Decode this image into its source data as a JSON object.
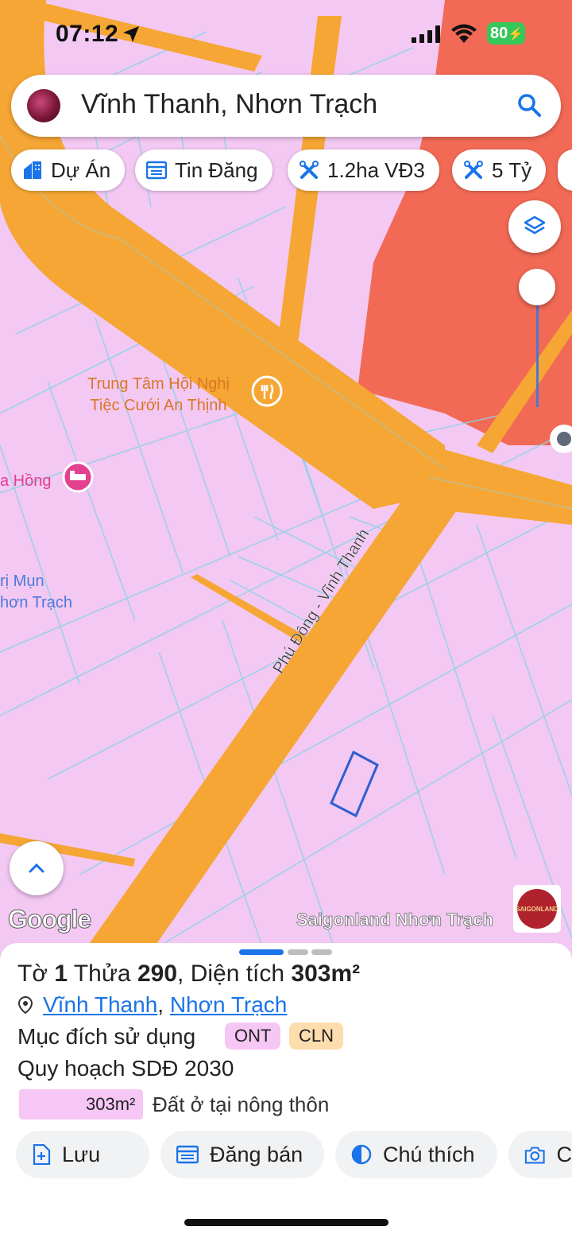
{
  "status": {
    "time": "07:12",
    "battery": "80"
  },
  "search": {
    "query": "Vĩnh Thanh, Nhơn Trạch"
  },
  "chips": [
    {
      "label": "Dự Án",
      "icon": "building-icon"
    },
    {
      "label": "Tin Đăng",
      "icon": "calendar-list-icon"
    },
    {
      "label": "1.2ha VĐ3",
      "icon": "tools-icon"
    },
    {
      "label": "5 Tỷ",
      "icon": "tools-icon"
    }
  ],
  "map": {
    "poi_event_line1": "Trung Tâm Hội Nghị",
    "poi_event_line2": "Tiệc Cưới An Thịnh",
    "poi_hotel": "a Hồng",
    "poi_clinic_line1": "rị Mụn",
    "poi_clinic_line2": "hơn Trạch",
    "road_name": "Phú Đông - Vĩnh Thanh",
    "google_label": "Google",
    "watermark": "Saigonland Nhơn Trạch",
    "logo_text": "SAIGONLAND",
    "colors": {
      "residential": "#f3c8f3",
      "road": "#f5a634",
      "commercial": "#f26a55",
      "parcel_lines": "#8fd3e8",
      "selected": "#2f5fd0"
    }
  },
  "sheet": {
    "title_prefix": "Tờ",
    "sheet_no": "1",
    "parcel_word": "Thửa",
    "parcel_no": "290",
    "area_label": "Diện tích",
    "area_value": "303m²",
    "address_part1": "Vĩnh Thanh",
    "address_sep": ",",
    "address_part2": "Nhơn Trạch",
    "usage_label": "Mục đích sử dụng",
    "usage_tags": [
      "ONT",
      "CLN"
    ],
    "plan_label": "Quy hoạch SDĐ 2030",
    "legend_area": "303m²",
    "legend_desc": "Đất ở tại nông thôn"
  },
  "actions": [
    {
      "label": "Lưu",
      "icon": "save-add-icon"
    },
    {
      "label": "Đăng bán",
      "icon": "post-sale-icon"
    },
    {
      "label": "Chú thích",
      "icon": "legend-half-circle-icon"
    },
    {
      "label": "C",
      "icon": "camera-icon"
    }
  ]
}
